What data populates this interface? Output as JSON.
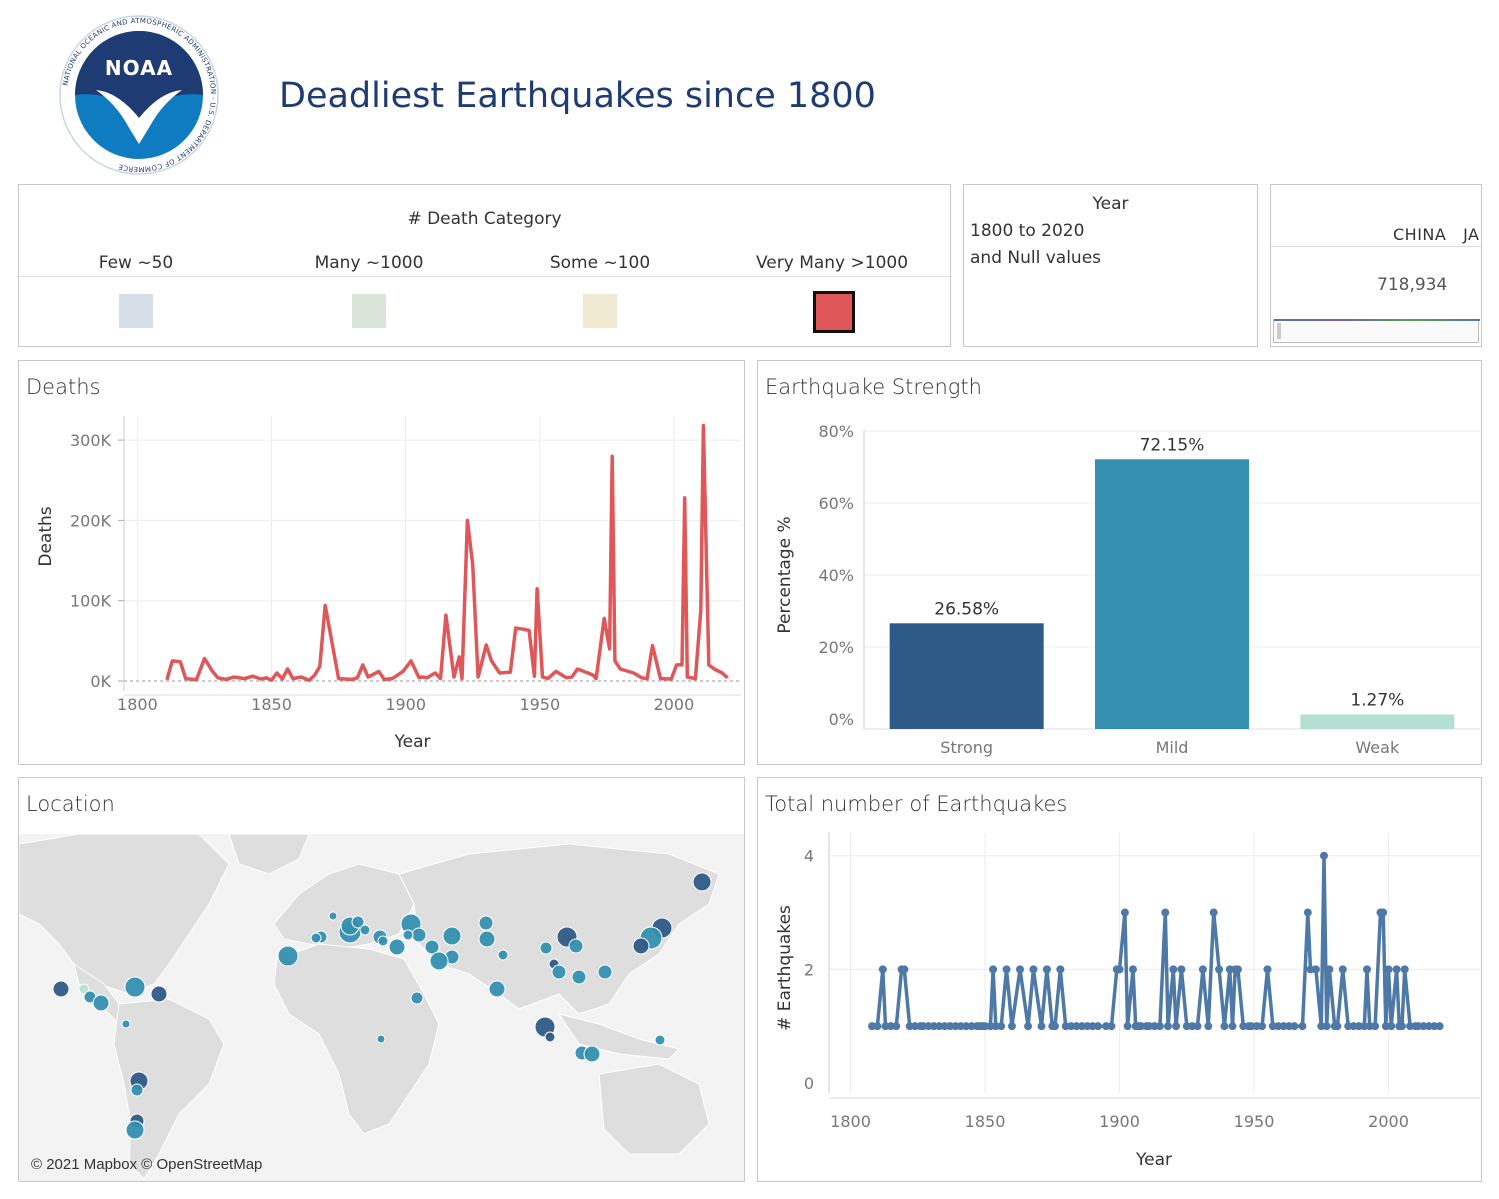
{
  "header": {
    "title": "Deadliest Earthquakes since 1800",
    "logo_text": "NOAA",
    "logo_ring_text": "NATIONAL OCEANIC AND ATMOSPHERIC ADMINISTRATION · U.S. DEPARTMENT OF COMMERCE"
  },
  "legend": {
    "title": "# Death Category",
    "items": [
      {
        "label": "Few ~50",
        "color": "#d6dfe8"
      },
      {
        "label": "Many ~1000",
        "color": "#d9e5d9"
      },
      {
        "label": "Some ~100",
        "color": "#f1ead2"
      },
      {
        "label": "Very Many >1000",
        "color": "#e05759",
        "selected": true
      }
    ]
  },
  "year_filter": {
    "title": "Year",
    "line1": "1800 to 2020",
    "line2": "and Null values"
  },
  "country_card": {
    "header": "CHINA   JA",
    "value": "718,934"
  },
  "colors": {
    "deaths_line": "#e05759",
    "strong": "#2e5a87",
    "mild": "#348fb0",
    "weak": "#b3e0d3",
    "count_line": "#4e79a7"
  },
  "deaths_panel": {
    "title": "Deaths"
  },
  "strength_panel": {
    "title": "Earthquake Strength"
  },
  "location_panel": {
    "title": "Location",
    "attribution": "© 2021 Mapbox © OpenStreetMap"
  },
  "count_panel": {
    "title": "Total number of Earthquakes"
  },
  "chart_data": [
    {
      "id": "deaths",
      "type": "line",
      "xlabel": "Year",
      "ylabel": "Deaths",
      "xlim": [
        1795,
        2025
      ],
      "ylim": [
        0,
        330000
      ],
      "xticks": [
        1800,
        1850,
        1900,
        1950,
        2000
      ],
      "yticks": [
        0,
        100000,
        200000,
        300000
      ],
      "ytick_labels": [
        "0K",
        "100K",
        "200K",
        "300K"
      ],
      "x": [
        1811,
        1813,
        1816,
        1818,
        1822,
        1825,
        1828,
        1830,
        1833,
        1836,
        1840,
        1843,
        1846,
        1848,
        1850,
        1852,
        1854,
        1856,
        1858,
        1861,
        1864,
        1866,
        1868,
        1870,
        1875,
        1880,
        1882,
        1884,
        1886,
        1890,
        1892,
        1895,
        1899,
        1902,
        1905,
        1906,
        1908,
        1911,
        1913,
        1915,
        1918,
        1920,
        1921,
        1923,
        1925,
        1927,
        1930,
        1932,
        1935,
        1939,
        1941,
        1943,
        1946,
        1948,
        1949,
        1951,
        1953,
        1956,
        1960,
        1962,
        1964,
        1968,
        1970,
        1971,
        1974,
        1976,
        1977,
        1978,
        1980,
        1985,
        1988,
        1990,
        1992,
        1995,
        1999,
        2001,
        2003,
        2004,
        2005,
        2008,
        2010,
        2011,
        2013,
        2015,
        2018,
        2020
      ],
      "y": [
        1500,
        25000,
        24000,
        3000,
        1500,
        28000,
        12000,
        4000,
        2000,
        5000,
        3000,
        6000,
        2500,
        4000,
        1000,
        10000,
        2500,
        15000,
        3000,
        5000,
        1000,
        7000,
        18000,
        94000,
        3000,
        2000,
        4000,
        20000,
        5000,
        12000,
        2000,
        3000,
        12000,
        25000,
        4000,
        5000,
        4000,
        10000,
        3000,
        82000,
        5000,
        30000,
        3000,
        200000,
        145000,
        5000,
        45000,
        25000,
        10000,
        11000,
        66000,
        65000,
        63000,
        6000,
        115000,
        5000,
        3000,
        12000,
        4000,
        5000,
        15000,
        10000,
        7000,
        3000,
        78000,
        40000,
        280000,
        25000,
        15000,
        10000,
        4000,
        3000,
        44000,
        3000,
        2500,
        20000,
        20000,
        228000,
        5000,
        3000,
        88000,
        318000,
        20000,
        15000,
        10000,
        4000
      ],
      "baseline_dashed": true
    },
    {
      "id": "strength",
      "type": "bar",
      "ylabel": "Percentage %",
      "categories": [
        "Strong",
        "Mild",
        "Weak"
      ],
      "values": [
        26.58,
        72.15,
        1.27
      ],
      "value_labels": [
        "26.58%",
        "72.15%",
        "1.27%"
      ],
      "ylim": [
        0,
        80
      ],
      "yticks": [
        0,
        20,
        40,
        60,
        80
      ],
      "ytick_labels": [
        "0%",
        "20%",
        "40%",
        "60%",
        "80%"
      ]
    },
    {
      "id": "count",
      "type": "line",
      "markers": true,
      "xlabel": "Year",
      "ylabel": "# Earthquakes",
      "xlim": [
        1792,
        2034
      ],
      "ylim": [
        0,
        4.4
      ],
      "xticks": [
        1800,
        1850,
        1900,
        1950,
        2000
      ],
      "yticks": [
        0,
        2,
        4
      ],
      "x": [
        1808,
        1810,
        1812,
        1813,
        1815,
        1817,
        1819,
        1820,
        1822,
        1824,
        1826,
        1827,
        1829,
        1831,
        1833,
        1835,
        1837,
        1839,
        1841,
        1843,
        1845,
        1847,
        1848,
        1849,
        1850,
        1852,
        1853,
        1854,
        1856,
        1858,
        1860,
        1863,
        1866,
        1868,
        1871,
        1873,
        1875,
        1876,
        1878,
        1880,
        1882,
        1884,
        1886,
        1888,
        1890,
        1892,
        1895,
        1897,
        1899,
        1900,
        1902,
        1903,
        1905,
        1906,
        1907,
        1908,
        1910,
        1911,
        1913,
        1915,
        1917,
        1918,
        1920,
        1921,
        1923,
        1925,
        1927,
        1929,
        1931,
        1933,
        1935,
        1937,
        1939,
        1941,
        1942,
        1943,
        1944,
        1946,
        1948,
        1949,
        1951,
        1953,
        1955,
        1957,
        1959,
        1961,
        1963,
        1965,
        1968,
        1970,
        1971,
        1973,
        1975,
        1976,
        1977,
        1978,
        1980,
        1981,
        1983,
        1985,
        1987,
        1989,
        1991,
        1992,
        1993,
        1995,
        1997,
        1998,
        1999,
        2000,
        2001,
        2003,
        2004,
        2005,
        2006,
        2008,
        2010,
        2011,
        2013,
        2015,
        2017,
        2019
      ],
      "y": [
        1,
        1,
        2,
        1,
        1,
        1,
        2,
        2,
        1,
        1,
        1,
        1,
        1,
        1,
        1,
        1,
        1,
        1,
        1,
        1,
        1,
        1,
        1,
        1,
        1,
        1,
        2,
        1,
        1,
        2,
        1,
        2,
        1,
        2,
        1,
        2,
        1,
        1,
        2,
        1,
        1,
        1,
        1,
        1,
        1,
        1,
        1,
        1,
        2,
        2,
        3,
        1,
        2,
        1,
        1,
        1,
        1,
        1,
        1,
        1,
        3,
        1,
        2,
        1,
        2,
        1,
        1,
        1,
        2,
        1,
        3,
        2,
        1,
        2,
        1,
        2,
        2,
        1,
        1,
        1,
        1,
        1,
        2,
        1,
        1,
        1,
        1,
        1,
        1,
        3,
        2,
        2,
        1,
        4,
        1,
        2,
        1,
        1,
        2,
        1,
        1,
        1,
        1,
        2,
        1,
        1,
        3,
        3,
        1,
        2,
        1,
        2,
        1,
        1,
        2,
        1,
        1,
        1,
        1,
        1,
        1,
        1
      ]
    }
  ]
}
